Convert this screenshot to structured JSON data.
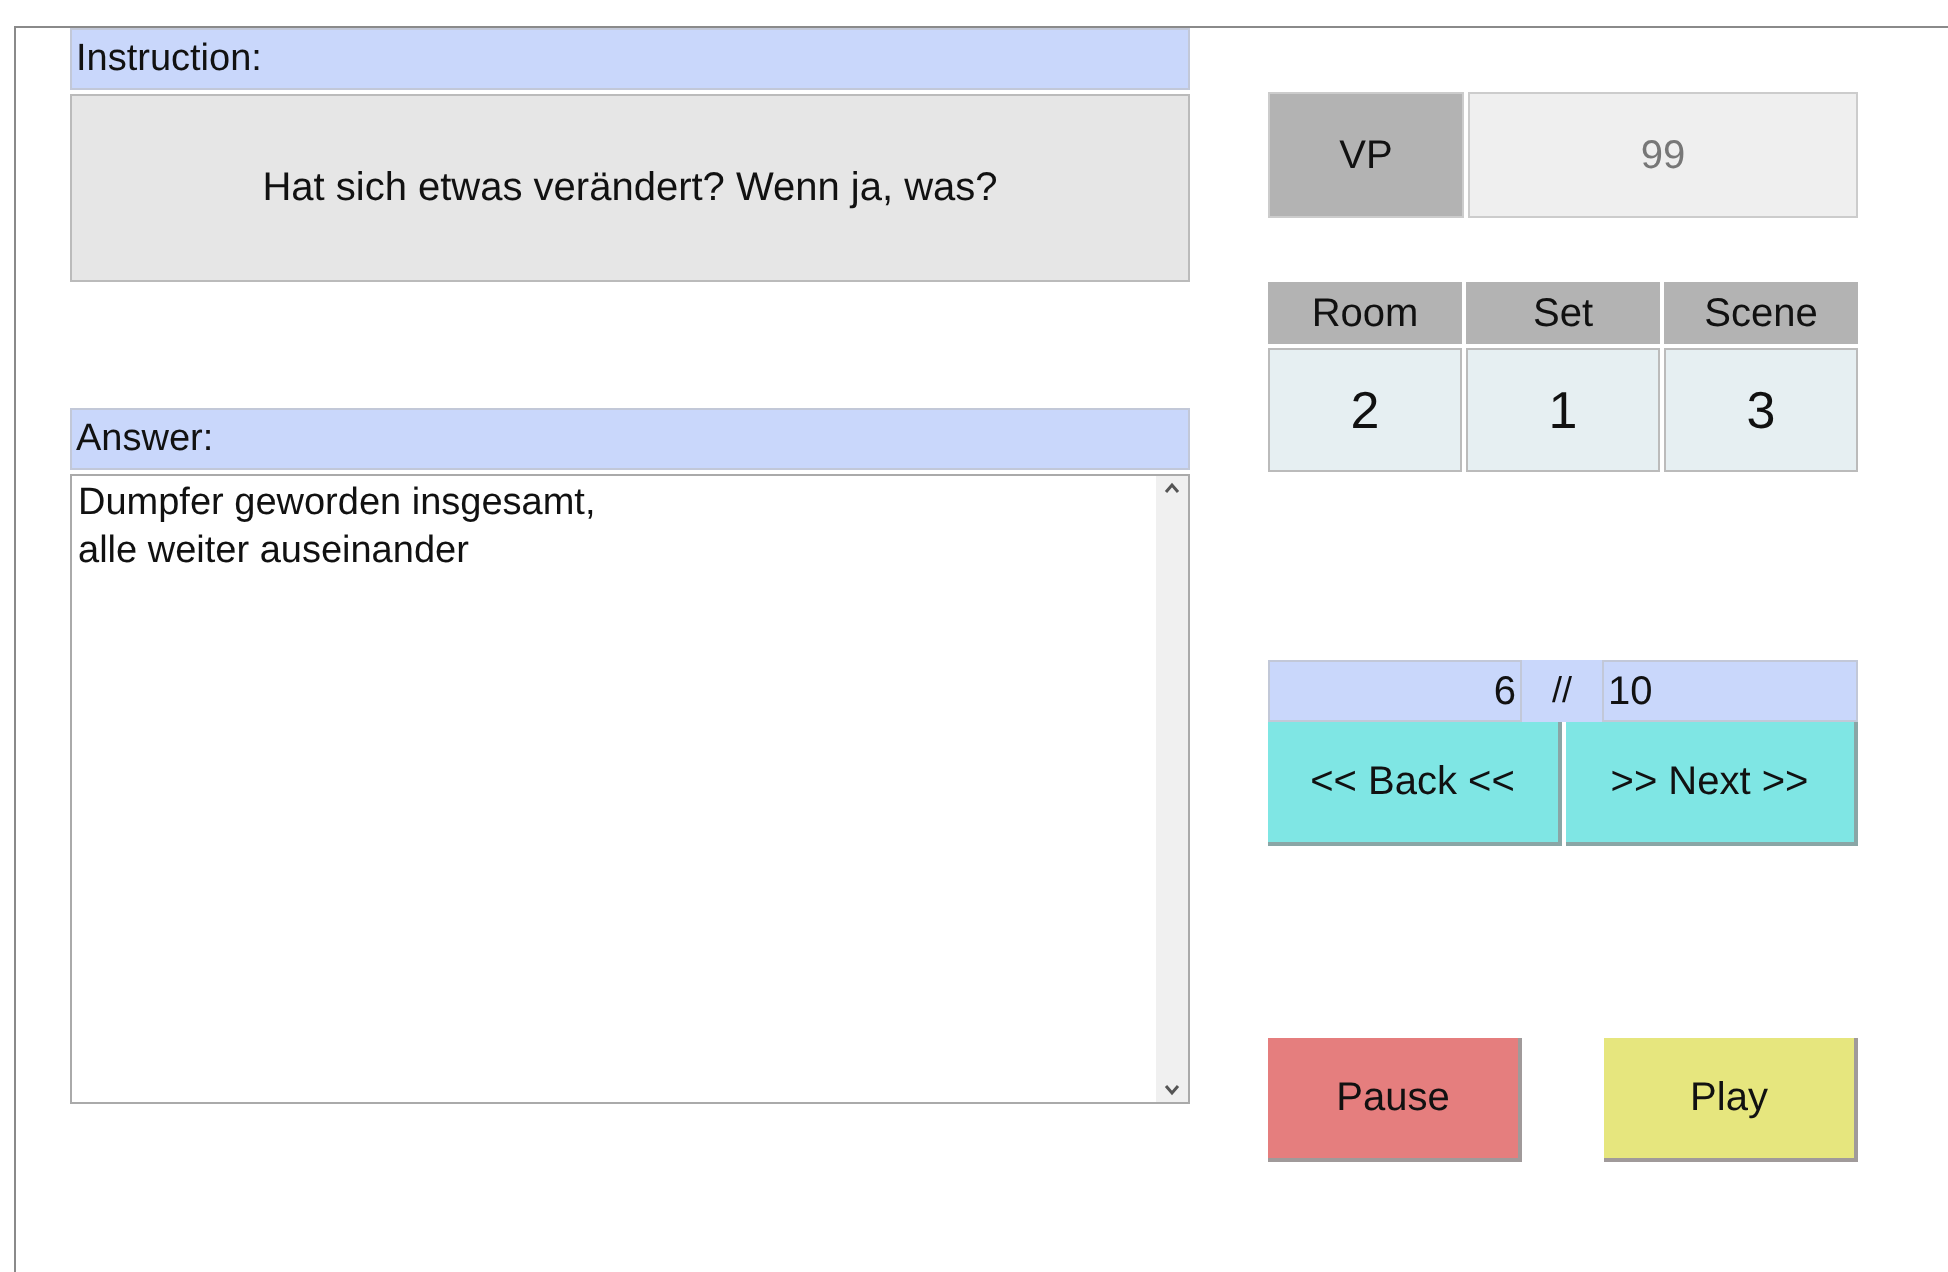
{
  "instruction": {
    "label": "Instruction:",
    "text": "Hat sich etwas verändert? Wenn ja, was?"
  },
  "answer": {
    "label": "Answer:",
    "value": "Dumpfer geworden insgesamt,\nalle weiter auseinander"
  },
  "vp": {
    "label": "VP",
    "value": "99"
  },
  "location": {
    "columns": [
      {
        "label": "Room",
        "value": "2"
      },
      {
        "label": "Set",
        "value": "1"
      },
      {
        "label": "Scene",
        "value": "3"
      }
    ]
  },
  "progress": {
    "current": "6",
    "separator": "//",
    "total": "10"
  },
  "navigation": [
    "<< Back <<",
    ">> Next >>"
  ],
  "playback": [
    {
      "label": "Pause",
      "kind": "pause"
    },
    {
      "label": "Play",
      "kind": "play"
    }
  ]
}
